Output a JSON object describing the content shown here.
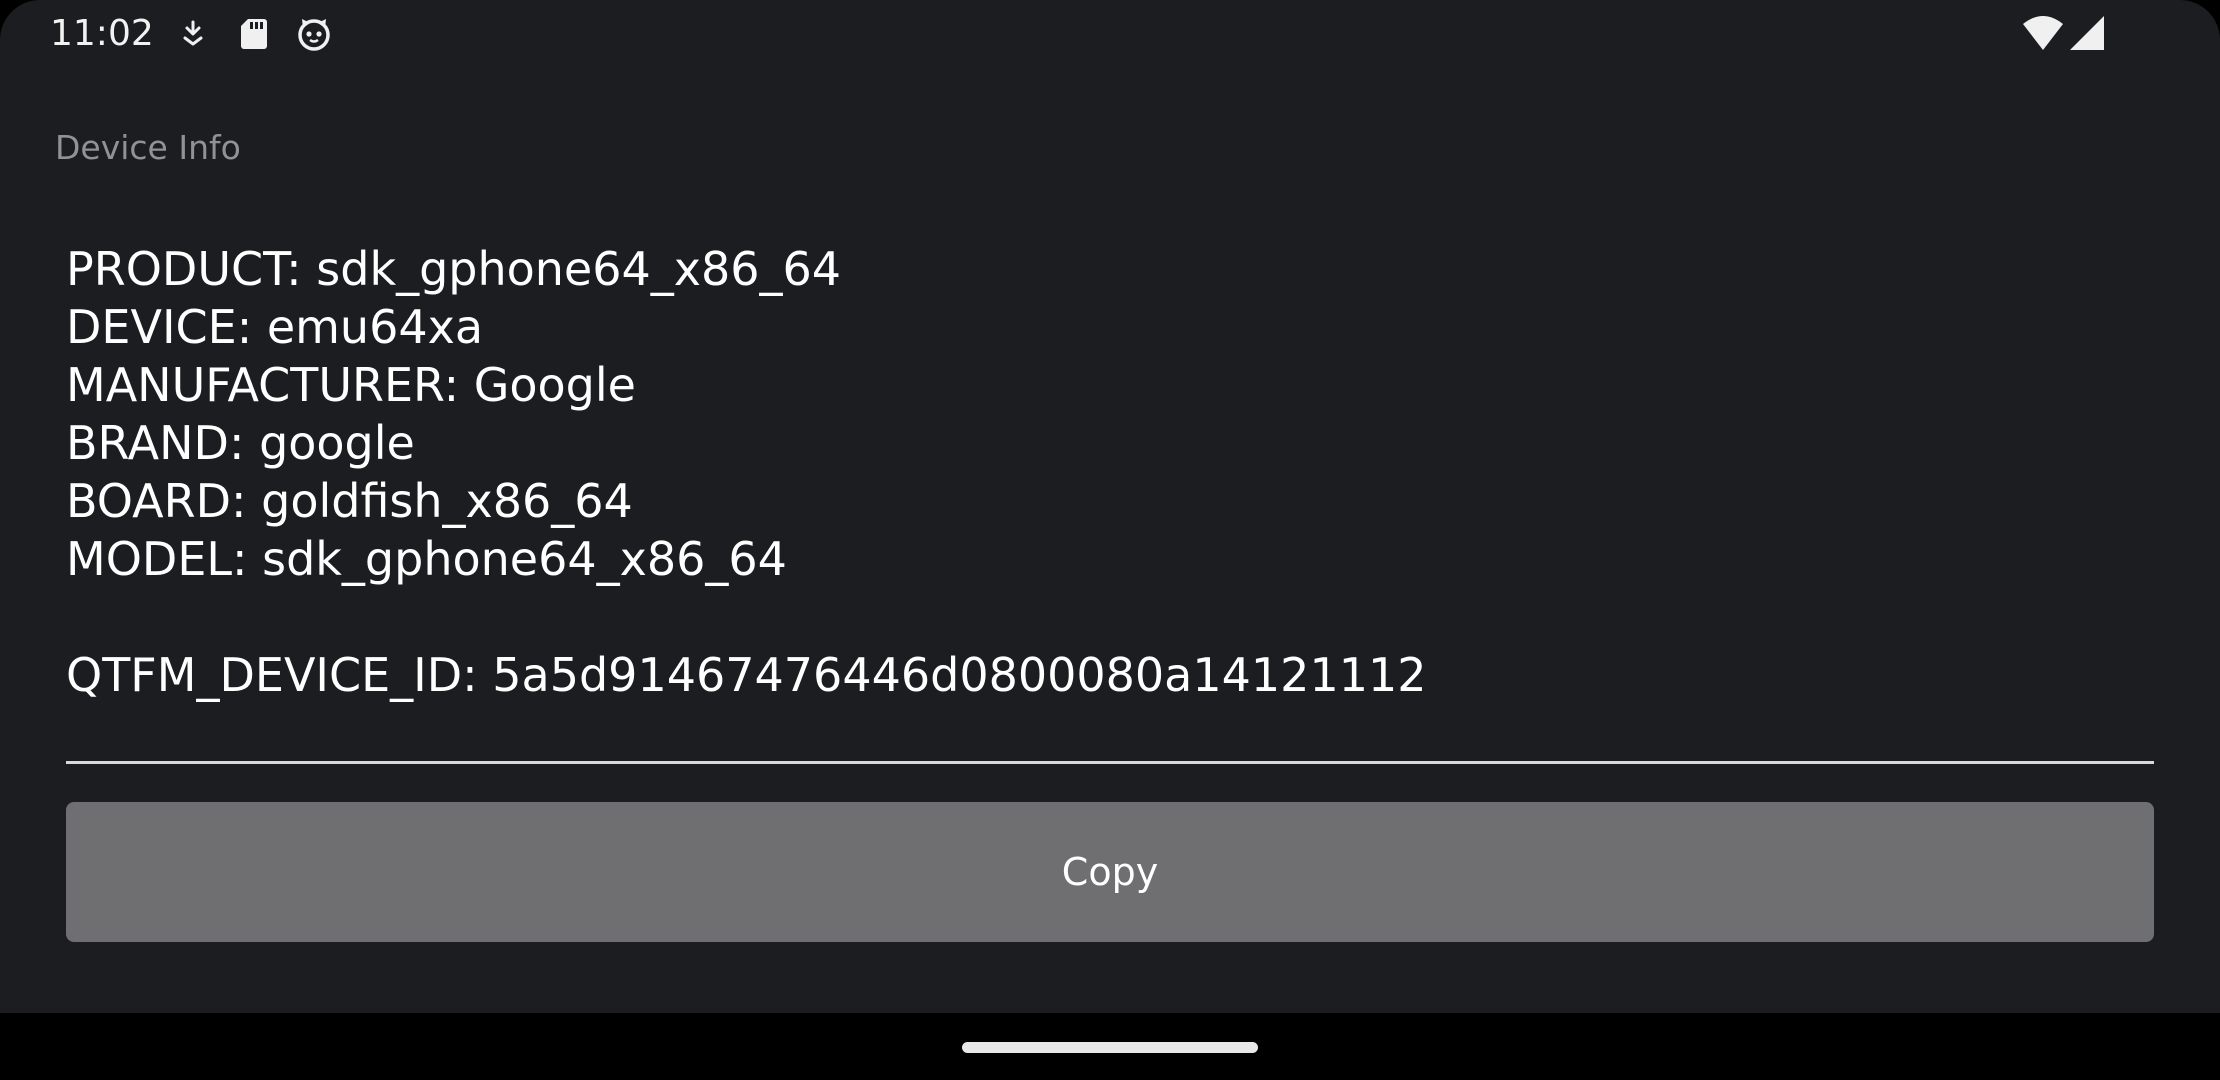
{
  "status_bar": {
    "time": "11:02",
    "left_icons": [
      "download-icon",
      "sd-card-icon",
      "cat-face-icon"
    ],
    "right_icons": [
      "wifi-icon",
      "cellular-signal-icon"
    ]
  },
  "dialog": {
    "title": "Device Info",
    "lines": [
      "PRODUCT: sdk_gphone64_x86_64",
      "DEVICE: emu64xa",
      "MANUFACTURER: Google",
      "BRAND: google",
      "BOARD: goldfish_x86_64",
      "MODEL: sdk_gphone64_x86_64",
      "",
      "QTFM_DEVICE_ID: 5a5d91467476446d0800080a14121112"
    ],
    "copy_label": "Copy"
  },
  "colors": {
    "background": "#1b1d20",
    "button": "#6f6f71",
    "title_text": "#8f9396",
    "nav_bar": "#000000"
  },
  "nav": {
    "home_handle": "home-gesture-handle"
  }
}
